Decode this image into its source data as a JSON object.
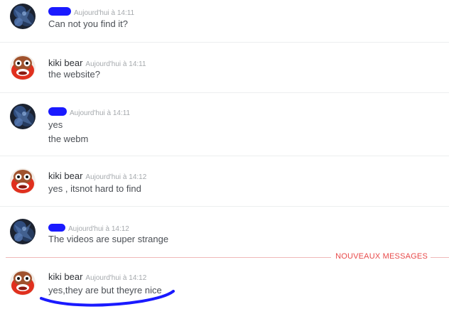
{
  "messages": [
    {
      "author": "",
      "author_redacted": true,
      "avatar": "dark-blue-avatar",
      "timestamp": "Aujourd'hui à 14:11",
      "lines": [
        "Can not you find it?"
      ]
    },
    {
      "author": "kiki bear",
      "author_redacted": false,
      "avatar": "red-cartoon-bear-avatar",
      "timestamp": "Aujourd'hui à 14:11",
      "lines": [
        "the website?"
      ]
    },
    {
      "author": "",
      "author_redacted": true,
      "avatar": "dark-blue-avatar",
      "timestamp": "Aujourd'hui à 14:11",
      "lines": [
        "yes",
        "the webm"
      ]
    },
    {
      "author": "kiki bear",
      "author_redacted": false,
      "avatar": "red-cartoon-bear-avatar",
      "timestamp": "Aujourd'hui à 14:12",
      "lines": [
        "yes , itsnot hard to find"
      ]
    },
    {
      "author": "",
      "author_redacted": true,
      "avatar": "dark-blue-avatar",
      "timestamp": "Aujourd'hui à 14:12",
      "lines": [
        "The videos are super strange"
      ]
    },
    {
      "author": "kiki bear",
      "author_redacted": false,
      "avatar": "red-cartoon-bear-avatar",
      "timestamp": "Aujourd'hui à 14:12",
      "lines": [
        "yes,they are but theyre nice"
      ]
    }
  ],
  "new_messages_label": "NOUVEAUX MESSAGES",
  "colors": {
    "new_messages_accent": "#e84a4a",
    "redaction_scribble": "#1a1aff",
    "timestamp": "#a5a9ad",
    "message_text": "#4b4f55"
  }
}
